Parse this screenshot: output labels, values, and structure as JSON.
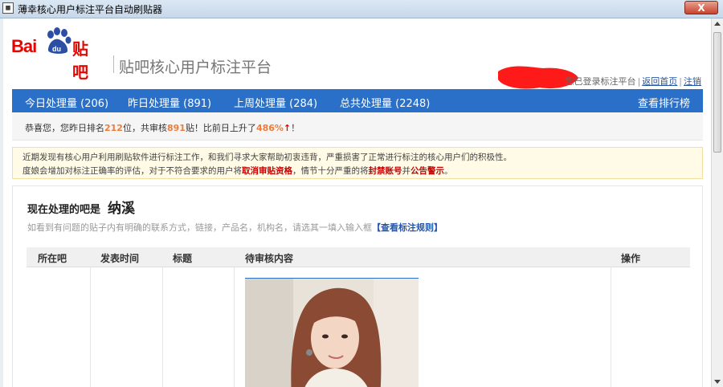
{
  "window": {
    "title": "薄幸核心用户标注平台自动刷贴器",
    "close_label": "X"
  },
  "header": {
    "logo_text_bai": "Bai",
    "logo_text_tieba": "贴吧",
    "platform_title": "贴吧核心用户标注平台",
    "logged_in_text": "您已登录标注平台",
    "back_home": "返回首页",
    "logout": "注销"
  },
  "nav": {
    "today": "今日处理量 (206)",
    "yesterday": "昨日处理量 (891)",
    "last_week": "上周处理量 (284)",
    "total": "总共处理量 (2248)",
    "rank": "查看排行榜"
  },
  "congrats": {
    "prefix": "恭喜您，您昨日排名",
    "rank": "212",
    "mid1": "位，共审核",
    "count": "891",
    "mid2": "贴！比前日上升了",
    "pct": "486%",
    "arrow": "↑",
    "suffix": "！"
  },
  "notice": {
    "line1": "近期发现有核心用户利用刷贴软件进行标注工作，和我们寻求大家帮助初衷违背，严重损害了正常进行标注的核心用户们的积极性。",
    "line2_a": "度娘会增加对标注正确率的评估，对于不符合要求的用户将",
    "line2_red1": "取消审贴资格",
    "line2_b": "，情节十分严重的将",
    "line2_red2": "封禁账号",
    "line2_c": "并",
    "line2_red3": "公告警示",
    "line2_d": "。"
  },
  "panel": {
    "now_label": "现在处理的吧是",
    "now_name": "纳溪",
    "hint": "如看到有问题的贴子内有明确的联系方式，链接，产品名，机构名，请选其一填入输入框",
    "rules_link": "【查看标注规则】"
  },
  "table": {
    "headers": [
      "所在吧",
      "发表时间",
      "标题",
      "待审核内容",
      "操作"
    ]
  },
  "colors": {
    "nav_blue": "#2a70c9",
    "baidu_red": "#e10602",
    "orange": "#ef7b3a"
  }
}
